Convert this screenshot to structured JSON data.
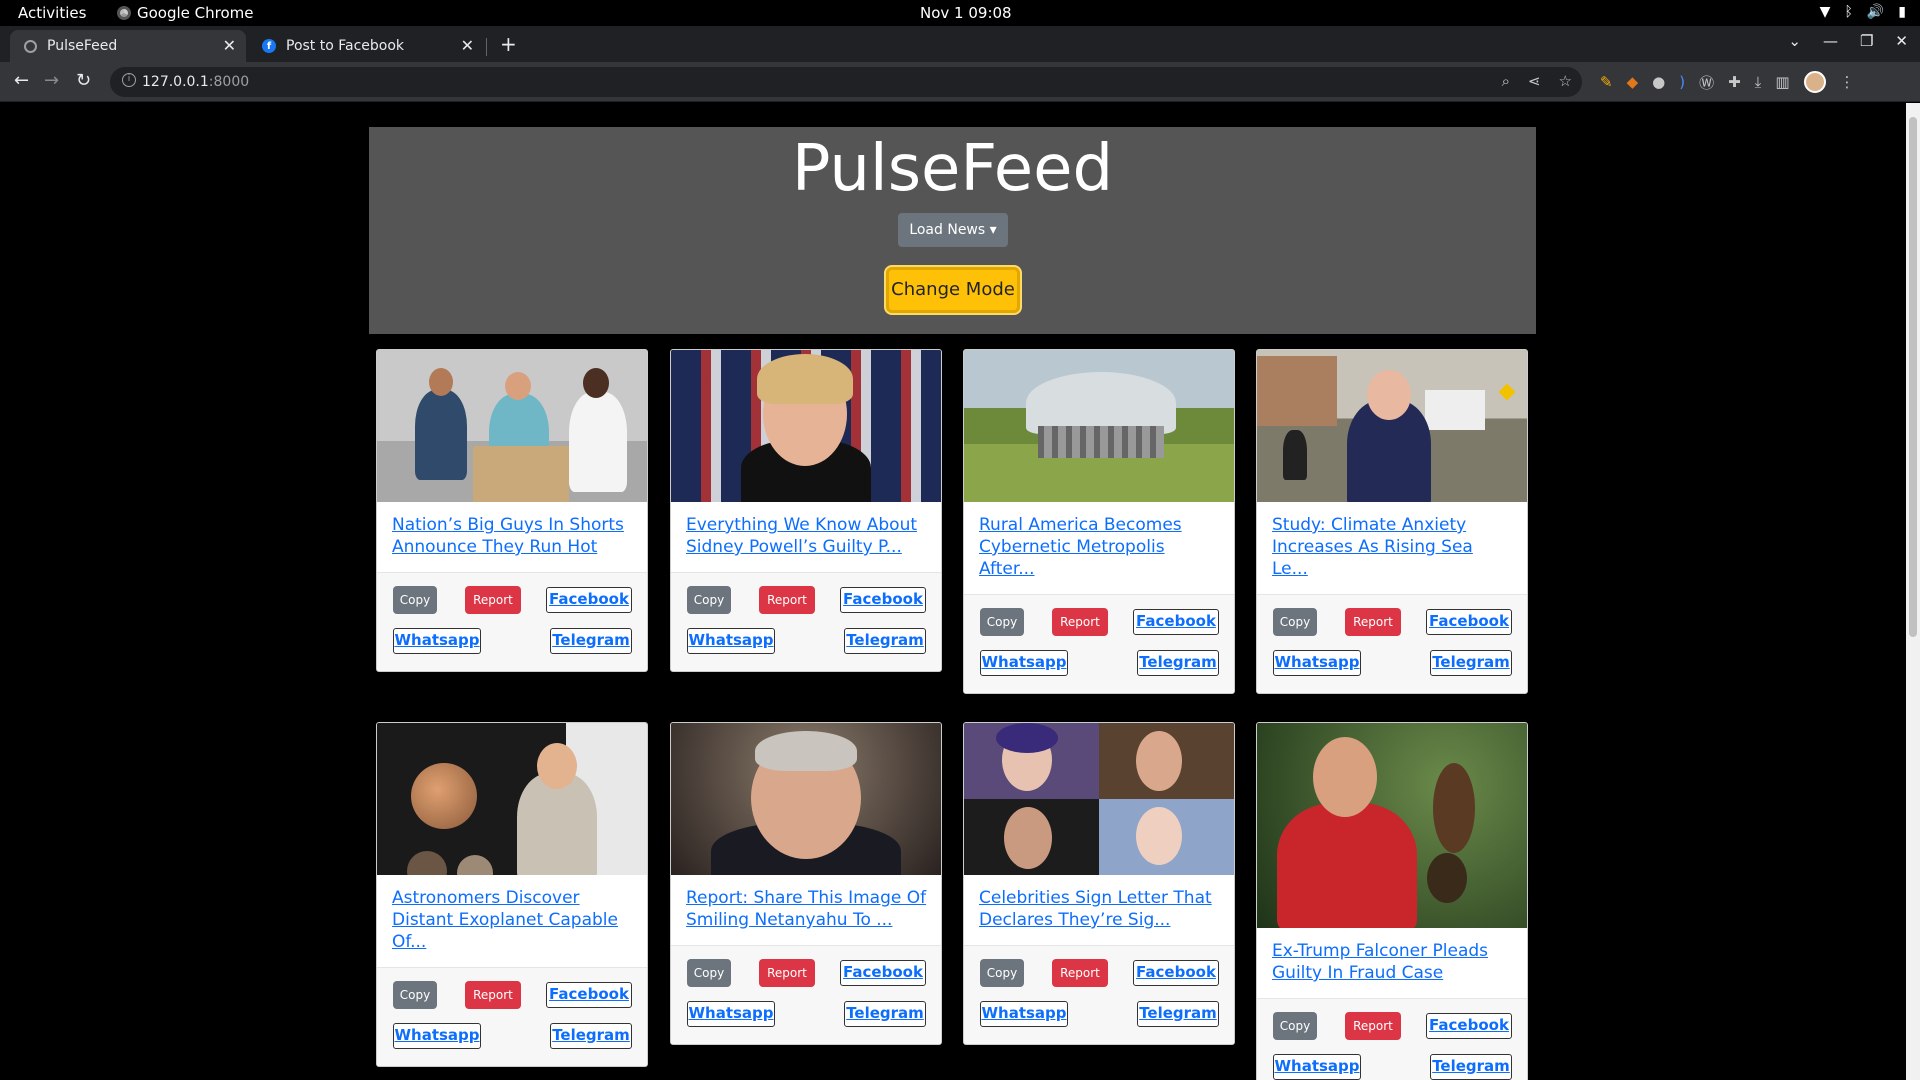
{
  "system": {
    "activities": "Activities",
    "app_name": "Google Chrome",
    "clock": "Nov 1  09:08"
  },
  "browser": {
    "tabs": [
      {
        "title": "PulseFeed",
        "active": true
      },
      {
        "title": "Post to Facebook",
        "active": false
      }
    ],
    "url_host": "127.0.0.1",
    "url_port": ":8000"
  },
  "page": {
    "site_title": "PulseFeed",
    "load_news_label": "Load News",
    "change_mode_label": "Change Mode",
    "buttons": {
      "copy": "Copy",
      "report": "Report",
      "facebook": "Facebook",
      "whatsapp": "Whatsapp",
      "telegram": "Telegram"
    },
    "articles": [
      {
        "title": "Nation’s Big Guys In Shorts Announce They Run Hot",
        "image": "three-men-podium"
      },
      {
        "title": "Everything We Know About Sidney Powell’s Guilty P...",
        "image": "woman-flags"
      },
      {
        "title": "Rural America Becomes Cybernetic Metropolis After...",
        "image": "dome-farmland"
      },
      {
        "title": "Study: Climate Anxiety Increases As Rising Sea Le...",
        "image": "flooded-street"
      },
      {
        "title": "Astronomers Discover Distant Exoplanet Capable Of...",
        "image": "lecturer-planet"
      },
      {
        "title": "Report: Share This Image Of Smiling Netanyahu To ...",
        "image": "smiling-man"
      },
      {
        "title": "Celebrities Sign Letter That Declares They’re Sig...",
        "image": "celebrity-grid"
      },
      {
        "title": "Ex-Trump Falconer Pleads Guilty In Fraud Case",
        "image": "falconer"
      }
    ]
  },
  "colors": {
    "header_bg": "#555555",
    "change_mode": "#ffc107",
    "report": "#dc3545",
    "copy": "#6c757d",
    "link": "#0d6efd"
  }
}
